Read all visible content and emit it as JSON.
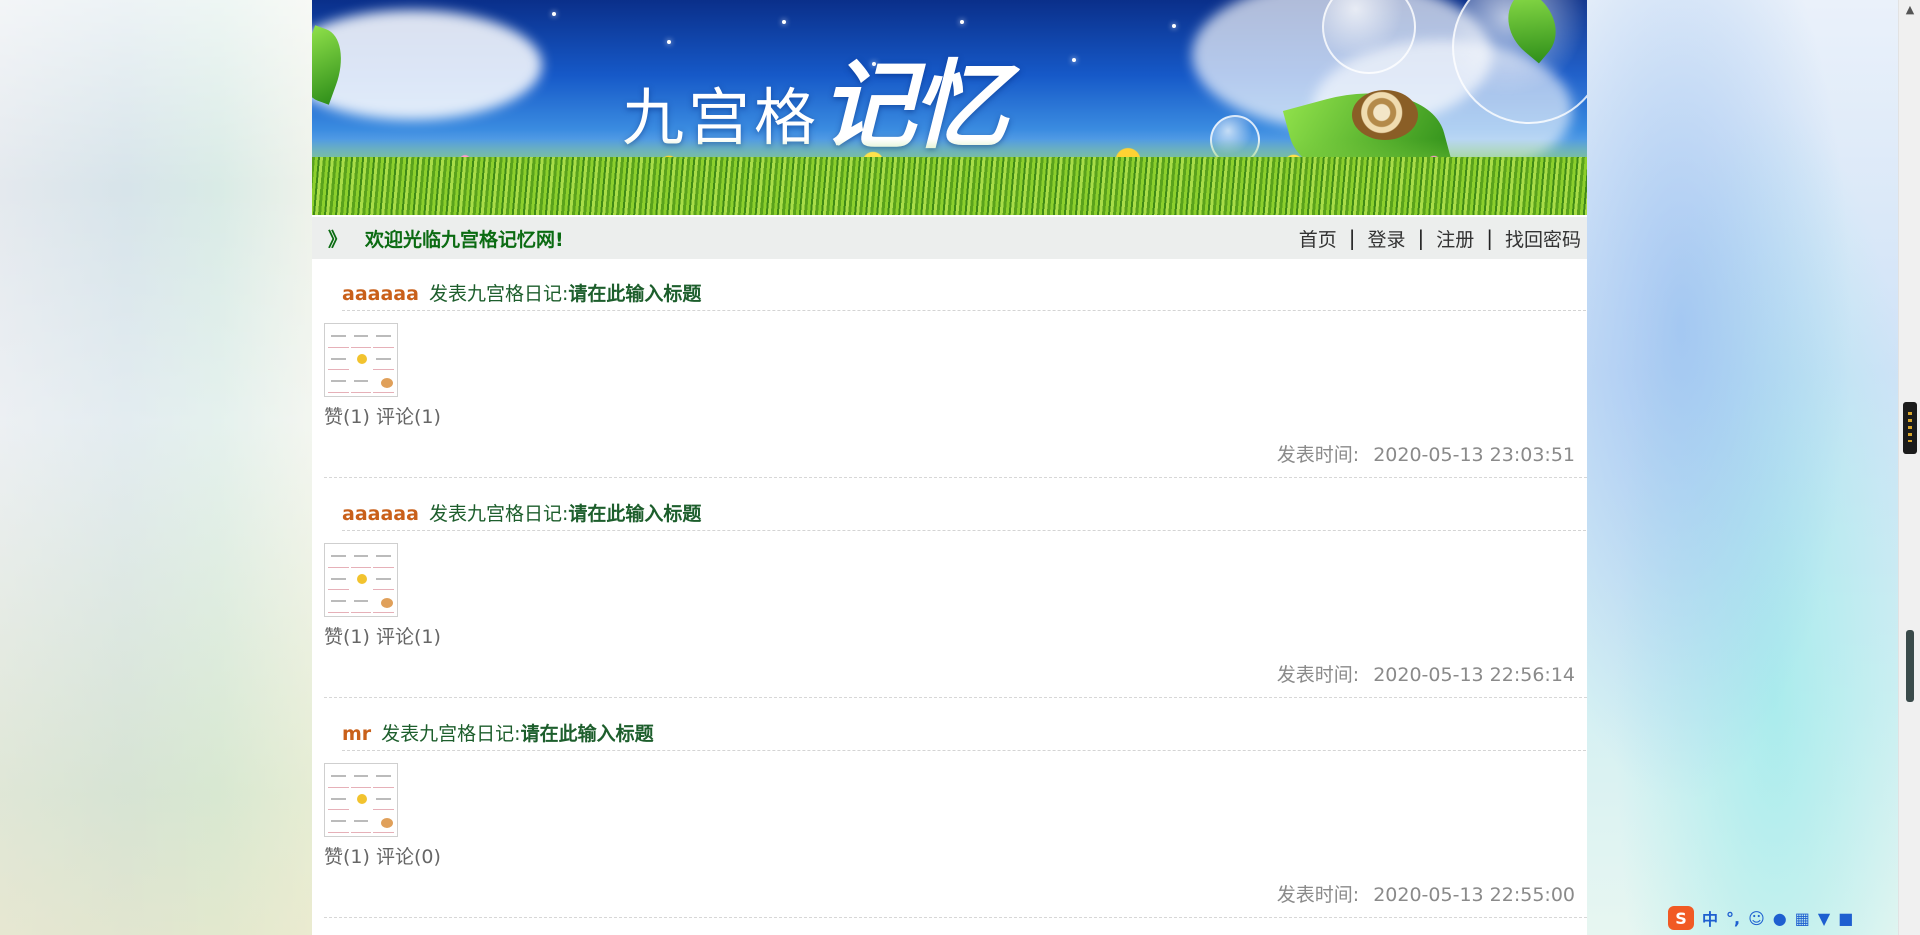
{
  "banner": {
    "title_plain": "九宫格",
    "title_script": "记忆"
  },
  "nav": {
    "chevron": "》",
    "welcome": "欢迎光临九宫格记忆网!",
    "separator": "|",
    "items": [
      {
        "label": "首页"
      },
      {
        "label": "登录"
      },
      {
        "label": "注册"
      },
      {
        "label": "找回密码"
      }
    ]
  },
  "posts": [
    {
      "author": "aaaaaa",
      "prefix": "发表九宫格日记:",
      "title": "请在此输入标题",
      "like": "赞(1)",
      "comment": "评论(1)",
      "time_label": "发表时间:",
      "time": "2020-05-13 23:03:51"
    },
    {
      "author": "aaaaaa",
      "prefix": "发表九宫格日记:",
      "title": "请在此输入标题",
      "like": "赞(1)",
      "comment": "评论(1)",
      "time_label": "发表时间:",
      "time": "2020-05-13 22:56:14"
    },
    {
      "author": "mr",
      "prefix": "发表九宫格日记:",
      "title": "请在此输入标题",
      "like": "赞(1)",
      "comment": "评论(0)",
      "time_label": "发表时间:",
      "time": "2020-05-13 22:55:00"
    }
  ],
  "ime": {
    "logo": "S",
    "mode": "中",
    "punct": "°,"
  },
  "scrollbar": {
    "up_arrow": "▲"
  },
  "colors": {
    "nav_green": "#0b6b12",
    "author_orange": "#c9601a",
    "title_green": "#1d5e2c",
    "time_gray": "#8a8a8a"
  }
}
